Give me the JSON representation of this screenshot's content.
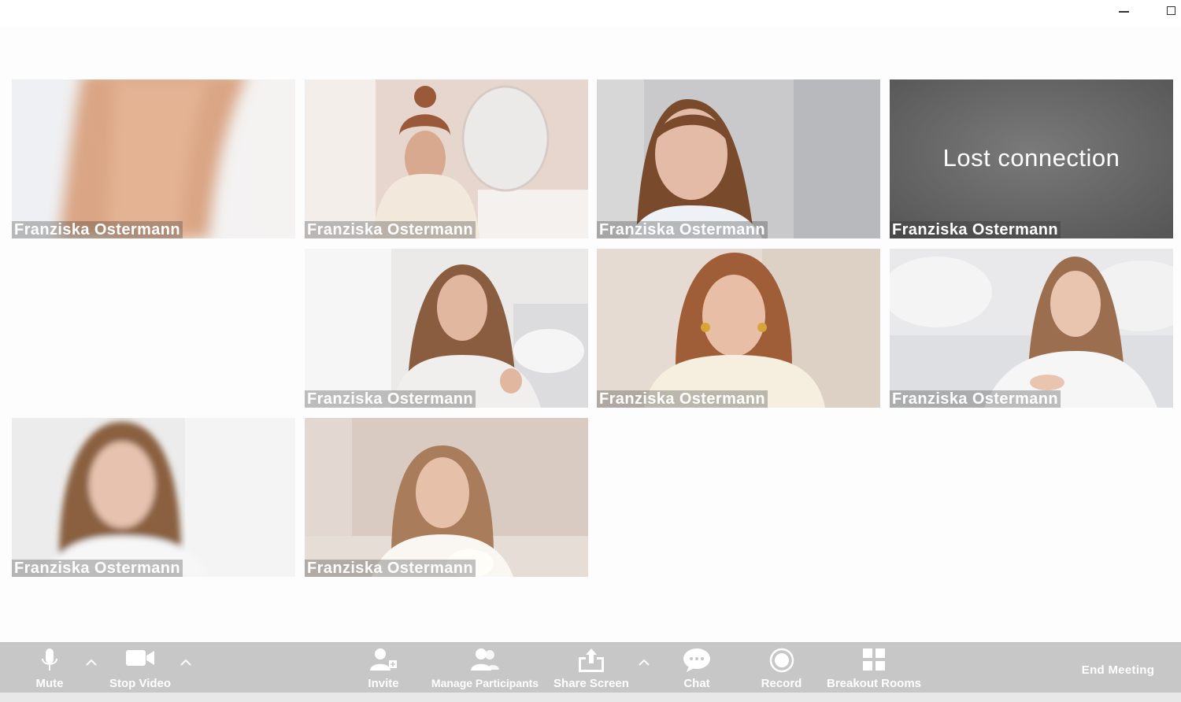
{
  "window": {
    "controls": [
      {
        "name": "minimize-icon"
      },
      {
        "name": "maximize-icon"
      }
    ]
  },
  "participants": [
    {
      "name": "Franziska Ostermann",
      "state": "blurred-arm"
    },
    {
      "name": "Franziska Ostermann",
      "state": "video"
    },
    {
      "name": "Franziska Ostermann",
      "state": "video"
    },
    {
      "name": "Franziska Ostermann",
      "state": "lost-connection",
      "status": "Lost connection"
    },
    {
      "name": "Franziska Ostermann",
      "state": "video"
    },
    {
      "name": "Franziska Ostermann",
      "state": "video"
    },
    {
      "name": "Franziska Ostermann",
      "state": "video"
    },
    {
      "name": "Franziska Ostermann",
      "state": "video"
    },
    {
      "name": "Franziska Ostermann",
      "state": "video"
    }
  ],
  "toolbar": {
    "mute": "Mute",
    "stop_video": "Stop Video",
    "invite": "Invite",
    "manage_participants": "Manage Participants",
    "share_screen": "Share Screen",
    "chat": "Chat",
    "record": "Record",
    "breakout_rooms": "Breakout Rooms",
    "end_meeting": "End Meeting"
  },
  "colors": {
    "toolbar_bg": "#c7c7c7",
    "toolbar_text": "#ffffff",
    "lost_tile_bg": "#6b6b6b"
  }
}
